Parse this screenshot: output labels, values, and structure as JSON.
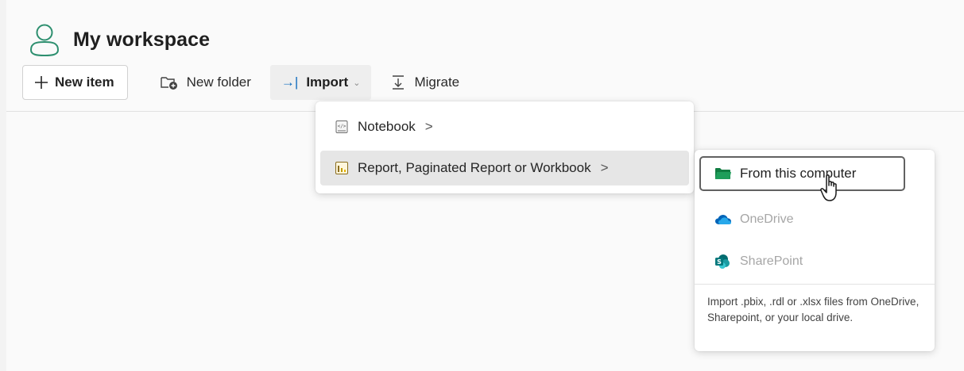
{
  "workspace": {
    "title": "My workspace",
    "icon": "user-workspace-icon"
  },
  "toolbar": {
    "new_item_label": "New item",
    "new_folder_label": "New folder",
    "import_label": "Import",
    "migrate_label": "Migrate"
  },
  "import_menu": {
    "items": [
      {
        "label": "Notebook",
        "icon": "notebook-icon",
        "has_submenu": true
      },
      {
        "label": "Report, Paginated Report or Workbook",
        "icon": "report-icon",
        "has_submenu": true,
        "highlighted": true
      }
    ]
  },
  "report_submenu": {
    "items": [
      {
        "label": "From this computer",
        "icon": "folder-icon",
        "focused": true,
        "enabled": true
      },
      {
        "label": "OneDrive",
        "icon": "onedrive-icon",
        "enabled": false
      },
      {
        "label": "SharePoint",
        "icon": "sharepoint-icon",
        "enabled": false
      }
    ],
    "description": "Import .pbix, .rdl or .xlsx files from OneDrive, Sharepoint, or your local drive."
  },
  "colors": {
    "accent_blue": "#0f6cbd",
    "folder_green": "#107c41",
    "onedrive_blue": "#0364b8",
    "sharepoint_teal": "#038387",
    "disabled_text": "#a6a6a6"
  }
}
